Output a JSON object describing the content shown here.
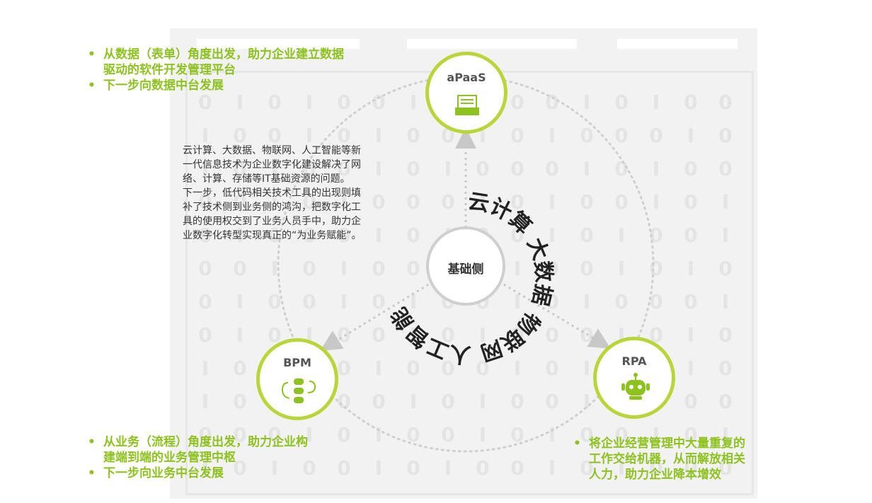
{
  "colors": {
    "accent_green": "#8dc21f",
    "ring_green": "#b8d63a",
    "center_gray": "#cfcfcf",
    "dotted_gray": "#c8c8c8",
    "background_digit": "#e4e4e4"
  },
  "diagram": {
    "center_label": "基础侧",
    "ring_text": "云计算 大数据 物联网 人工智能",
    "nodes": {
      "apaas": {
        "label": "aPaaS",
        "icon": "form-icon"
      },
      "bpm": {
        "label": "BPM",
        "icon": "workflow-icon"
      },
      "rpa": {
        "label": "RPA",
        "icon": "robot-icon"
      }
    }
  },
  "apaas_text": {
    "bullet": "•",
    "line1": "从数据（表单）角度出发，助力企业建立数据",
    "line2": "驱动的软件开发管理平台",
    "line3": "下一步向数据中台发展"
  },
  "bpm_text": {
    "bullet": "•",
    "line1": "从业务（流程）角度出发，助力企业构",
    "line2": "建端到端的业务管理中枢",
    "line3": "下一步向业务中台发展"
  },
  "rpa_text": {
    "bullet": "•",
    "line1": "将企业经营管理中大量重复的",
    "line2": "工作交给机器，从而解放相关",
    "line3": "人力，助力企业降本增效"
  },
  "description": {
    "p1": "云计算、大数据、物联网、人工智能等新一代信息技术为企业数字化建设解决了网络、计算、存储等IT基础资源的问题。",
    "p2": "下一步，低代码相关技术工具的出现则填补了技术侧到业务侧的鸿沟，把数字化工具的使用权交到了业务人员手中，助力企业数字化转型实现真正的“为业务赋能”。"
  }
}
